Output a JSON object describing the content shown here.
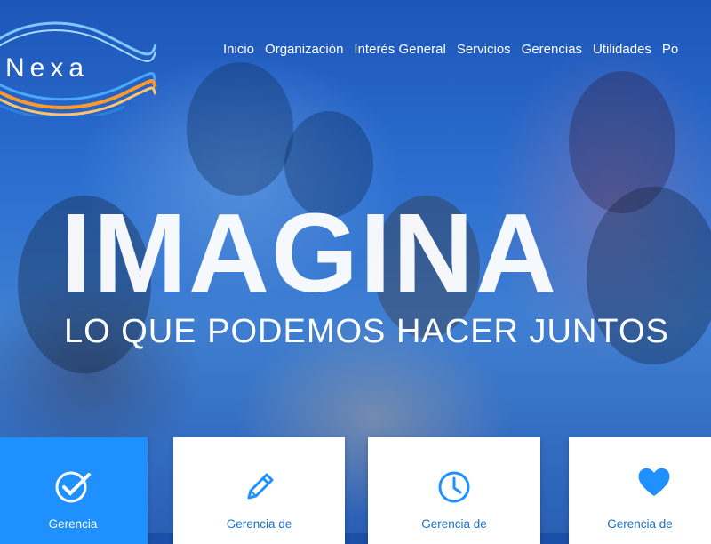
{
  "brand": {
    "name": "rNexa"
  },
  "nav": {
    "items": [
      "Inicio",
      "Organización",
      "Interés General",
      "Servicios",
      "Gerencias",
      "Utilidades"
    ],
    "overflow": "Po"
  },
  "hero": {
    "headline": "IMAGINA",
    "subline": "LO QUE PODEMOS HACER JUNTOS"
  },
  "cards": [
    {
      "label": "Gerencia",
      "icon": "check-circle-icon",
      "active": true
    },
    {
      "label": "Gerencia de",
      "icon": "pencil-icon",
      "active": false
    },
    {
      "label": "Gerencia de",
      "icon": "clock-icon",
      "active": false
    },
    {
      "label": "Gerencia de",
      "icon": "heart-icon",
      "active": false
    }
  ],
  "colors": {
    "accent": "#1e90ff",
    "card_text": "#1a6fc8",
    "hero_blue": "#2c6fd0"
  }
}
